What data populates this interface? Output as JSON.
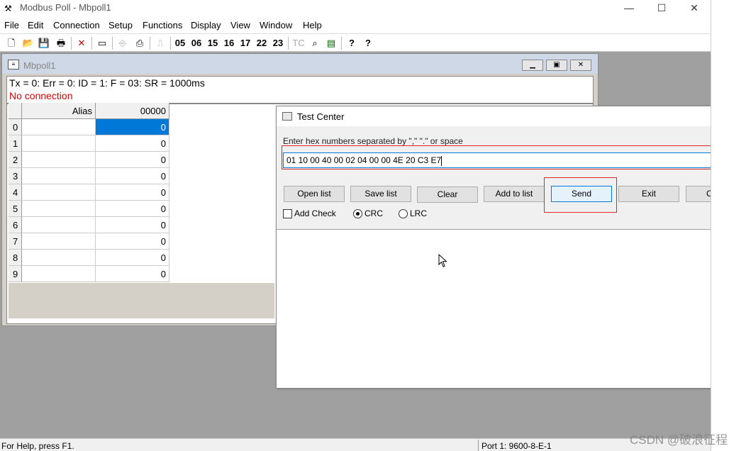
{
  "app": {
    "title": "Modbus Poll - Mbpoll1",
    "minimize": "—",
    "maximize": "☐",
    "close": "✕"
  },
  "menu": [
    {
      "label": "File"
    },
    {
      "label": "Edit"
    },
    {
      "label": "Connection"
    },
    {
      "label": "Setup"
    },
    {
      "label": "Functions"
    },
    {
      "label": "Display"
    },
    {
      "label": "View"
    },
    {
      "label": "Window"
    },
    {
      "label": "Help"
    }
  ],
  "toolbar": {
    "fc_buttons": [
      "05",
      "06",
      "15",
      "16",
      "17",
      "22",
      "23"
    ],
    "tc_label": "TC",
    "help_glyph": "?",
    "whats_this_glyph": "?"
  },
  "child": {
    "title": "Mbpoll1",
    "status_line": "Tx = 0: Err = 0: ID = 1: F = 03: SR = 1000ms",
    "connection_status": "No connection",
    "connection_color": "#e00000"
  },
  "grid": {
    "col_alias": "Alias",
    "col_addr": "00000",
    "rows": [
      {
        "index": "0",
        "value": "0"
      },
      {
        "index": "1",
        "value": "0"
      },
      {
        "index": "2",
        "value": "0"
      },
      {
        "index": "3",
        "value": "0"
      },
      {
        "index": "4",
        "value": "0"
      },
      {
        "index": "5",
        "value": "0"
      },
      {
        "index": "6",
        "value": "0"
      },
      {
        "index": "7",
        "value": "0"
      },
      {
        "index": "8",
        "value": "0"
      },
      {
        "index": "9",
        "value": "0"
      }
    ]
  },
  "dialog": {
    "title": "Test Center",
    "close": "✕",
    "prompt": "Enter hex numbers separated by \",\"  \".\" or space",
    "hex_value": "01 10 00 40 00 02 04 00 00 4E 20 C3 E7",
    "buttons": {
      "open_list": "Open list",
      "save_list": "Save list",
      "clear": "Clear",
      "add_to_list": "Add to list",
      "send": "Send",
      "exit": "Exit",
      "copy": "Copy"
    },
    "add_check": "Add Check",
    "crc": "CRC",
    "lrc": "LRC",
    "highlight_color": "#e0262b"
  },
  "statusbar": {
    "help": "For Help, press F1.",
    "port": "Port 1: 9600-8-E-1"
  },
  "watermark": "CSDN @破浪征程"
}
